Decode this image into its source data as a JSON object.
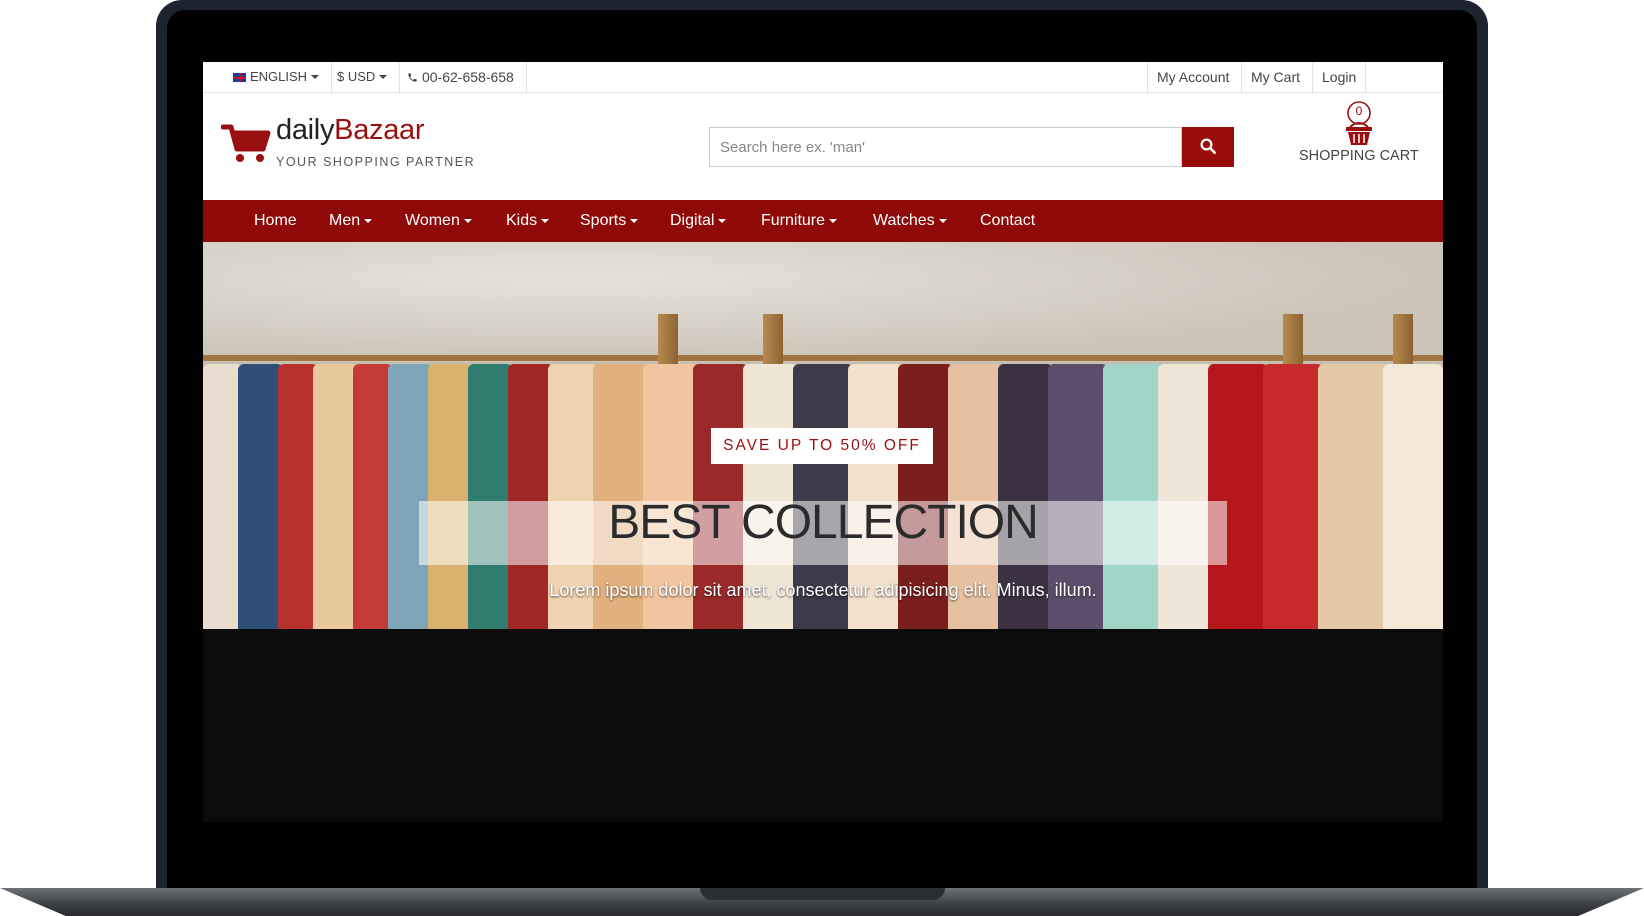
{
  "topbar": {
    "language": "ENGLISH",
    "currency": "$ USD",
    "phone": "00-62-658-658",
    "my_account": "My Account",
    "my_cart": "My Cart",
    "login": "Login"
  },
  "header": {
    "logo_part1": "daily",
    "logo_part2": "Bazaar",
    "tagline": "YOUR SHOPPING PARTNER",
    "search_placeholder": "Search here ex. 'man'",
    "cart_count": "0",
    "cart_label": "SHOPPING CART"
  },
  "nav": {
    "items": [
      {
        "label": "Home"
      },
      {
        "label": "Men"
      },
      {
        "label": "Women"
      },
      {
        "label": "Kids"
      },
      {
        "label": "Sports"
      },
      {
        "label": "Digital"
      },
      {
        "label": "Furniture"
      },
      {
        "label": "Watches"
      },
      {
        "label": "Contact"
      }
    ]
  },
  "hero": {
    "badge": "SAVE UP TO 50% OFF",
    "title": "BEST COLLECTION",
    "subtitle": "Lorem ipsum dolor sit amet, consectetur adipisicing elit. Minus, illum."
  },
  "colors": {
    "brand": "#9a0f0f",
    "nav_bg": "#8f0909"
  },
  "icons": [
    "flag-uk-icon",
    "caret-down-icon",
    "phone-icon",
    "shopping-cart-logo-icon",
    "search-icon",
    "basket-icon"
  ]
}
